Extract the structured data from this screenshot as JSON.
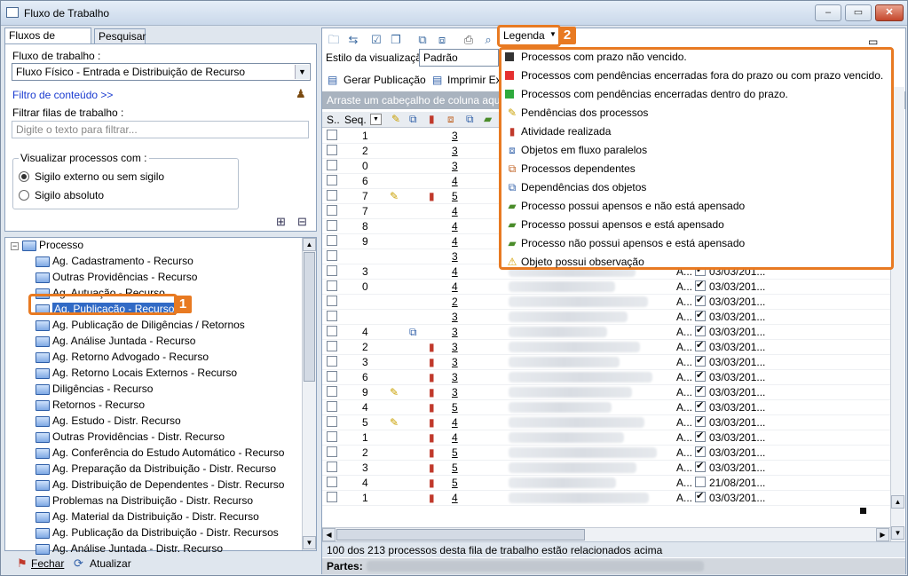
{
  "window": {
    "title": "Fluxo de Trabalho",
    "min": "–",
    "max": "▭",
    "close": "✕"
  },
  "left": {
    "tabs": [
      "Fluxos de trabalho",
      "Pesquisar"
    ],
    "workflow_label": "Fluxo de trabalho :",
    "workflow_value": "Fluxo Físico - Entrada e Distribuição de Recurso",
    "content_filter": "Filtro de conteúdo >>",
    "filter_label": "Filtrar filas de trabalho :",
    "filter_placeholder": "Digite o texto para filtrar...",
    "visualize_label": "Visualizar processos com :",
    "radio1": "Sigilo externo ou sem sigilo",
    "radio2": "Sigilo absoluto",
    "tree_root": "Processo",
    "tree_items": [
      "Ag. Cadastramento - Recurso",
      "Outras Providências - Recurso",
      "Ag. Autuação - Recurso",
      "Ag. Publicação - Recurso",
      "Ag. Publicação de Diligências / Retornos",
      "Ag. Análise Juntada - Recurso",
      "Ag. Retorno Advogado - Recurso",
      "Ag. Retorno Locais Externos - Recurso",
      "Diligências - Recurso",
      "Retornos - Recurso",
      "Ag. Estudo - Distr. Recurso",
      "Outras Providências - Distr. Recurso",
      "Ag. Conferência do Estudo Automático - Recurso",
      "Ag. Preparação da Distribuição - Distr. Recurso",
      "Ag. Distribuição de Dependentes - Distr. Recurso",
      "Problemas na Distribuição - Distr. Recurso",
      "Ag. Material da Distribuição - Distr. Recurso",
      "Ag. Publicação da Distribuição - Distr. Recursos",
      "Ag. Análise Juntada - Distr. Recurso"
    ],
    "close_btn": "Fechar",
    "refresh_btn": "Atualizar",
    "badge1": "1"
  },
  "right": {
    "legend_btn": "Legenda",
    "badge2": "2",
    "view_style_label": "Estilo da visualização :",
    "view_style_value": "Padrão",
    "gen_pub": "Gerar Publicação",
    "print": "Imprimir Ex",
    "drag_hint": "Arraste um cabeçalho de coluna aqui pa",
    "col_s": "S..",
    "col_seq": "Seq.",
    "rows_seq": [
      "1",
      "2",
      "0",
      "6",
      "7",
      "7",
      "8",
      "9",
      "",
      "3",
      "0",
      "",
      "",
      "4",
      "2",
      "3",
      "6",
      "9",
      "4",
      "5",
      "1",
      "2",
      "3",
      "4",
      "1",
      "",
      ""
    ],
    "rows_link": [
      "3",
      "3",
      "3",
      "4",
      "5",
      "4",
      "4",
      "4",
      "3",
      "4",
      "4",
      "2",
      "3",
      "3",
      "3",
      "3",
      "3",
      "3",
      "5",
      "4",
      "4",
      "5",
      "5",
      "5",
      "4",
      "2",
      "1"
    ],
    "rows_date": [
      "03/03/201...",
      "03/03/201...",
      "03/03/201...",
      "03/03/201...",
      "03/03/201...",
      "03/03/201...",
      "03/03/201...",
      "03/03/201...",
      "03/03/201...",
      "03/03/201...",
      "03/03/201...",
      "03/03/201...",
      "03/03/201...",
      "03/03/201...",
      "03/03/201...",
      "21/08/201...",
      "03/03/201..."
    ],
    "row_a": "A...",
    "status": "100 dos 213 processos desta fila de trabalho estão relacionados acima",
    "partes": "Partes:"
  },
  "legend": [
    {
      "text": "Processos com prazo não vencido.",
      "color": "#333333"
    },
    {
      "text": "Processos com pendências encerradas fora do prazo ou com prazo vencido.",
      "color": "#e53030"
    },
    {
      "text": "Processos com pendências encerradas dentro do prazo.",
      "color": "#2eaa3c"
    },
    {
      "text": "Pendências dos processos",
      "icon": "note-icon"
    },
    {
      "text": "Atividade realizada",
      "icon": "activity-icon"
    },
    {
      "text": "Objetos em fluxo paralelos",
      "icon": "parallel-icon"
    },
    {
      "text": "Processos dependentes",
      "icon": "dependent-icon"
    },
    {
      "text": "Dependências dos objetos",
      "icon": "dependency-icon"
    },
    {
      "text": "Processo possui apensos e não está apensado",
      "icon": "folder-icon"
    },
    {
      "text": "Processo possui apensos e está apensado",
      "icon": "folder-icon"
    },
    {
      "text": "Processo não possui apensos e está apensado",
      "icon": "folder-icon"
    },
    {
      "text": "Objeto possui observação",
      "icon": "warning-icon"
    }
  ]
}
